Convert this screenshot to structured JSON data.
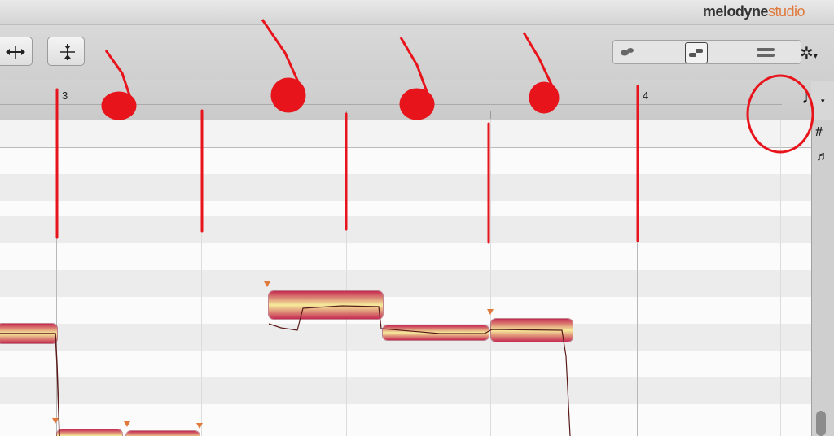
{
  "app": {
    "brand_bold": "melodyne",
    "brand_light": "studio"
  },
  "toolbar": {
    "buttons": [
      {
        "name": "tool-horizontal",
        "glyph": "↔"
      },
      {
        "name": "tool-vertical",
        "glyph": "↕"
      }
    ],
    "settings_glyph": "✲"
  },
  "ruler": {
    "bars": [
      "3",
      "4"
    ]
  },
  "note_value_glyph": "♩",
  "sidebar_icons": [
    "#",
    "♬"
  ]
}
